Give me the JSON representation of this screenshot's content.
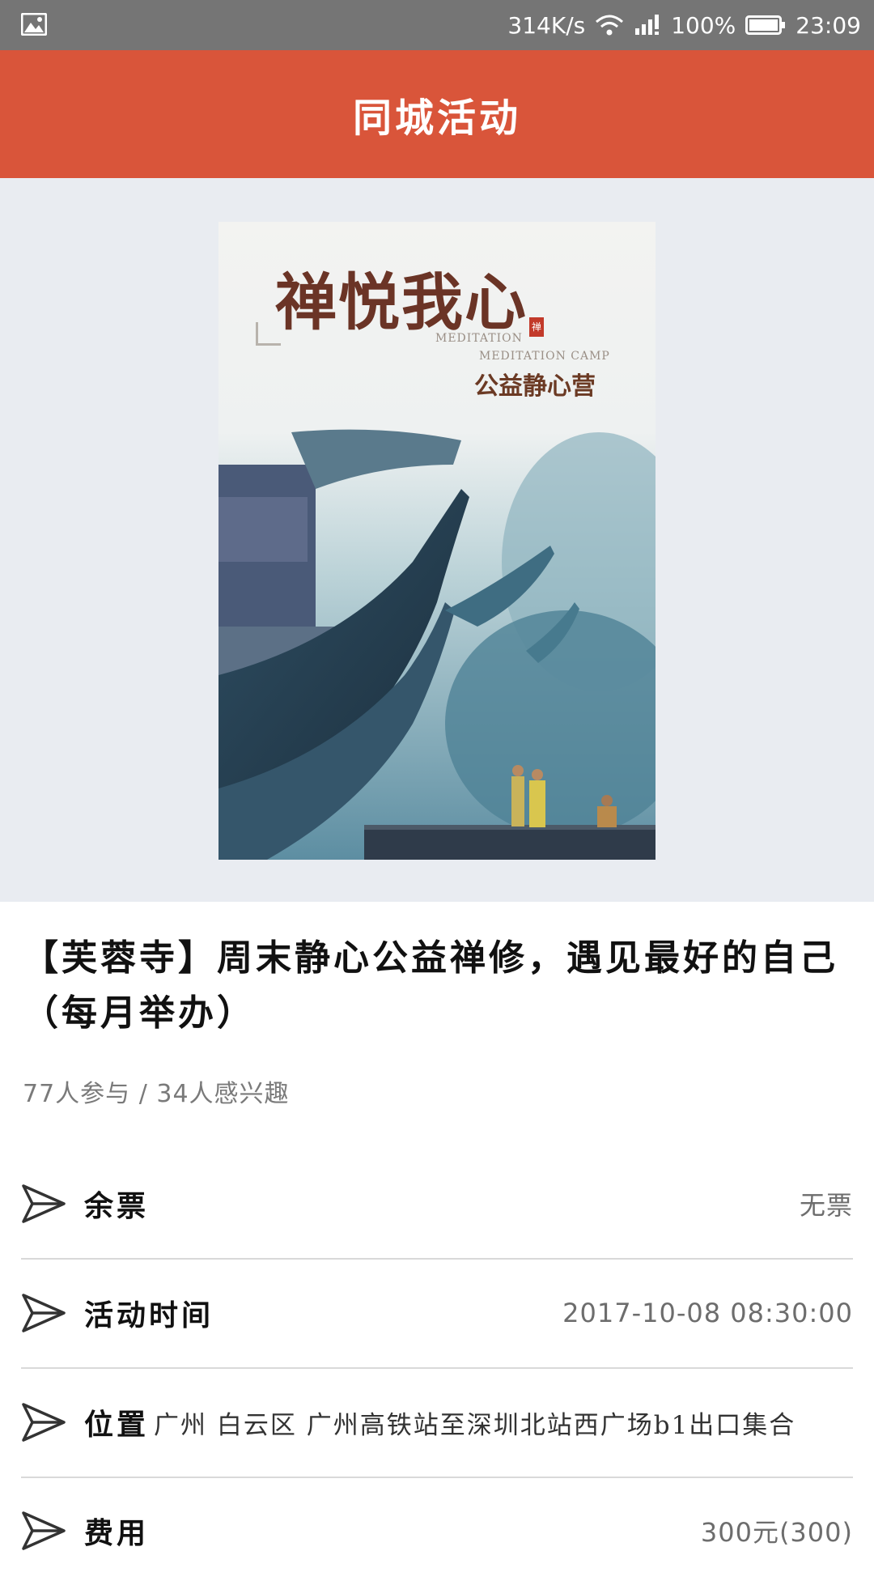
{
  "status_bar": {
    "speed": "314K/s",
    "battery": "100%",
    "time": "23:09",
    "icons": [
      "image-notification-icon",
      "wifi-icon",
      "signal-icon",
      "battery-icon"
    ]
  },
  "header": {
    "title": "同城活动"
  },
  "poster": {
    "title": "禅悦我心",
    "en_line1": "MEDITATION",
    "en_line2": "MEDITATION CAMP",
    "subtitle": "公益静心营",
    "seal": "禅"
  },
  "event": {
    "title": "【芙蓉寺】周末静心公益禅修，遇见最好的自己（每月举办）",
    "participants": "77人参与 / 34人感兴趣"
  },
  "info": [
    {
      "label": "余票",
      "value": "无票"
    },
    {
      "label": "活动时间",
      "value": "2017-10-08 08:30:00"
    },
    {
      "label": "位置",
      "value": "广州 白云区 广州高铁站至深圳北站西广场b1出口集合"
    },
    {
      "label": "费用",
      "value": "300元(300)"
    }
  ],
  "colors": {
    "accent": "#d9553a",
    "status_bar": "#757575",
    "poster_bg": "#e9ecf1"
  }
}
